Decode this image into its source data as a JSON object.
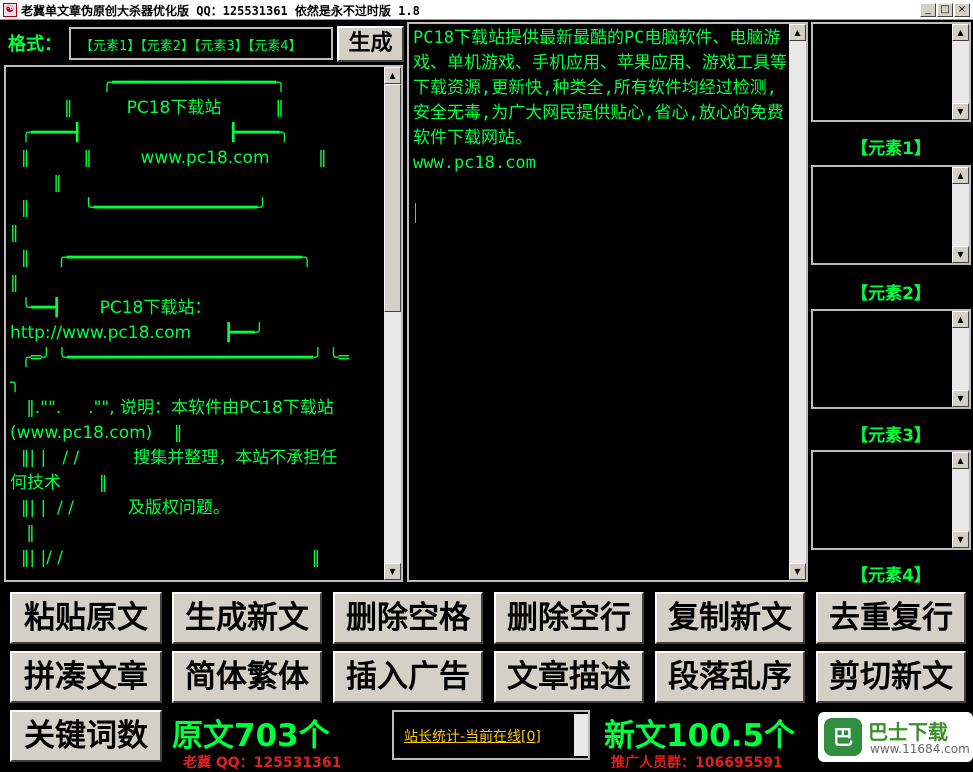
{
  "window": {
    "title": "老冀单文章伪原创大杀器优化版 QQ：125531361 依然是永不过时版 1.8",
    "minimize_glyph": "_",
    "maximize_glyph": "□",
    "close_glyph": "×"
  },
  "format": {
    "label": "格式：",
    "template": "【元素1】【元素2】【元素3】【元素4】",
    "generate_label": "生成"
  },
  "source_text": "                 ╭━━━━━━━━━━━━━━━━╮\n          ‖          PC18下载站          ‖\n  ╭━━━━┫                           ┣━━━━╮\n  ‖          ‖         www.pc18.com         ‖\n        ‖\n  ‖          ╰━━━━━━━━━━━━━━━━╯\n‖\n  ‖     ╭━━━━━━━━━━━━━━━━━━━━━━━╮\n‖\n  ╰━━┫       PC18下载站：\nhttp://www.pc18.com      ┣━━╯\n  ╭═╯ ╰━━━━━━━━━━━━━━━━━━━━━━━━╯ ╰═\n╮\n   ‖.\"\".     .\"\", 说明：本软件由PC18下载站\n(www.pc18.com)    ‖\n  ‖| |   / /          搜集并整理，本站不承担任\n何技术       ‖\n  ‖| |  / /          及版权问题。\n   ‖\n  ‖| |/ /                                              ‖",
  "new_text": "PC18下载站提供最新最酷的PC电脑软件、电脑游戏、单机游戏、手机应用、苹果应用、游戏工具等下载资源,更新快,种类全,所有软件均经过检测,安全无毒,为广大网民提供贴心,省心,放心的免费软件下载网站。\nwww.pc18.com",
  "elements": [
    {
      "label": "【元素1】"
    },
    {
      "label": "【元素2】"
    },
    {
      "label": "【元素3】"
    },
    {
      "label": "【元素4】"
    }
  ],
  "buttons_row1": [
    "粘贴原文",
    "生成新文",
    "删除空格",
    "删除空行",
    "复制新文",
    "去重复行"
  ],
  "buttons_row2": [
    "拼凑文章",
    "简体繁体",
    "插入广告",
    "文章描述",
    "段落乱序",
    "剪切新文"
  ],
  "keyword_button": "关键词数",
  "original_count": "原文703个",
  "new_count": "新文100.5个",
  "author_qq": "老冀 QQ：125531361",
  "promoter_group": "推广人员群：106695591",
  "stats_link": "站长统计-当前在线[0]",
  "watermark": {
    "logo_glyph": "巴",
    "title": "巴士下载",
    "url": "www.11684.com"
  },
  "scroll_glyphs": {
    "up": "▲",
    "down": "▼"
  }
}
